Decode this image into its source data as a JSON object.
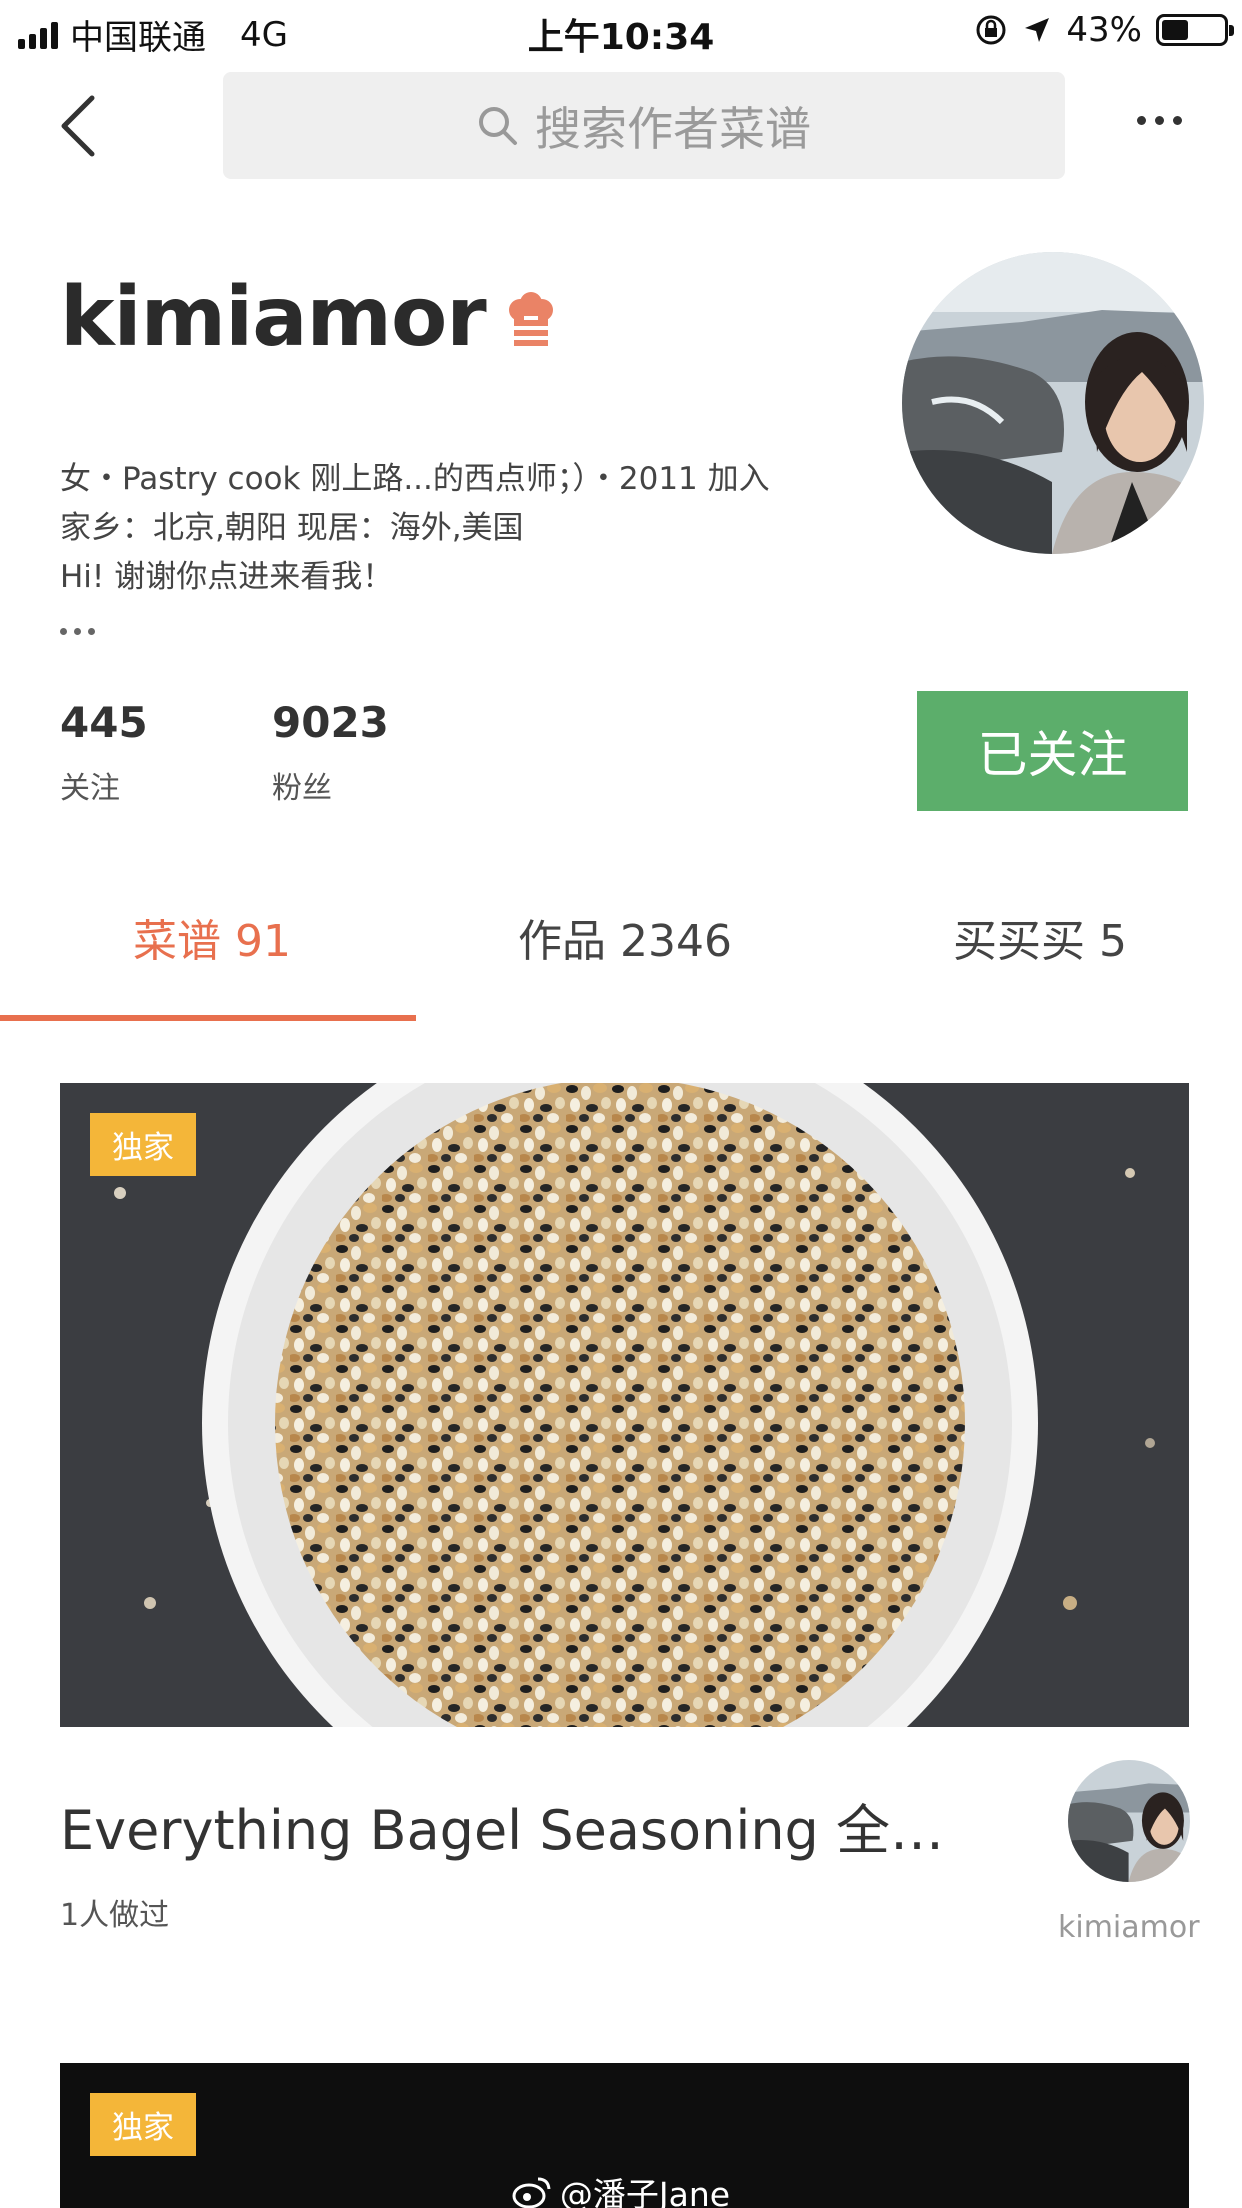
{
  "status_bar": {
    "carrier": "中国联通",
    "network": "4G",
    "time": "上午10:34",
    "battery": "43%",
    "battery_level": 0.43
  },
  "nav": {
    "search_placeholder": "搜索作者菜谱"
  },
  "profile": {
    "name": "kimiamor",
    "bio_line1": "女・Pastry cook 刚上路...的西点师；）・2011 加入",
    "bio_line2": "家乡：北京,朝阳  现居：海外,美国",
    "bio_line3": "Hi! 谢谢你点进来看我！",
    "following_count": "445",
    "following_label": "关注",
    "followers_count": "9023",
    "followers_label": "粉丝",
    "follow_button": "已关注"
  },
  "tabs": [
    {
      "label": "菜谱 91",
      "active": true
    },
    {
      "label": "作品 2346",
      "active": false
    },
    {
      "label": "买买买 5",
      "active": false
    }
  ],
  "recipes": [
    {
      "badge": "独家",
      "title": "Everything Bagel Seasoning 全…",
      "made_count": "1人做过",
      "author": "kimiamor"
    },
    {
      "badge": "独家"
    }
  ],
  "watermark": "@潘子Jane",
  "colors": {
    "accent": "#e8704e",
    "follow_green": "#5cae6b",
    "badge_yellow": "#f4b639"
  }
}
